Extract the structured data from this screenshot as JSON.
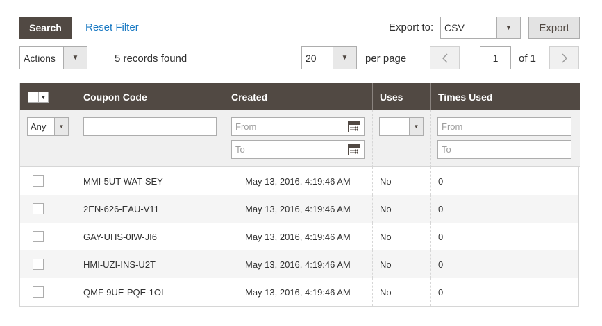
{
  "toolbar": {
    "search_label": "Search",
    "reset_label": "Reset Filter",
    "export_to_label": "Export to:",
    "export_format": "CSV",
    "export_label": "Export",
    "actions_label": "Actions",
    "records_found": "5 records found",
    "per_page_value": "20",
    "per_page_label": "per page",
    "current_page": "1",
    "page_of": "of 1"
  },
  "grid": {
    "columns": [
      "Coupon Code",
      "Created",
      "Uses",
      "Times Used"
    ],
    "filters": {
      "massaction_value": "Any",
      "coupon_code_value": "",
      "created_from_placeholder": "From",
      "created_to_placeholder": "To",
      "uses_value": "",
      "times_used_from_placeholder": "From",
      "times_used_to_placeholder": "To"
    },
    "rows": [
      {
        "code": "MMI-5UT-WAT-SEY",
        "created": "May 13, 2016, 4:19:46 AM",
        "uses": "No",
        "times_used": "0"
      },
      {
        "code": "2EN-626-EAU-V11",
        "created": "May 13, 2016, 4:19:46 AM",
        "uses": "No",
        "times_used": "0"
      },
      {
        "code": "GAY-UHS-0IW-JI6",
        "created": "May 13, 2016, 4:19:46 AM",
        "uses": "No",
        "times_used": "0"
      },
      {
        "code": "HMI-UZI-INS-U2T",
        "created": "May 13, 2016, 4:19:46 AM",
        "uses": "No",
        "times_used": "0"
      },
      {
        "code": "QMF-9UE-PQE-1OI",
        "created": "May 13, 2016, 4:19:46 AM",
        "uses": "No",
        "times_used": "0"
      }
    ]
  },
  "colors": {
    "header_bg": "#514943",
    "link": "#1979c3",
    "button_dark": "#514943"
  },
  "icons": [
    "chevron-down-icon",
    "chevron-left-icon",
    "chevron-right-icon",
    "calendar-icon"
  ]
}
